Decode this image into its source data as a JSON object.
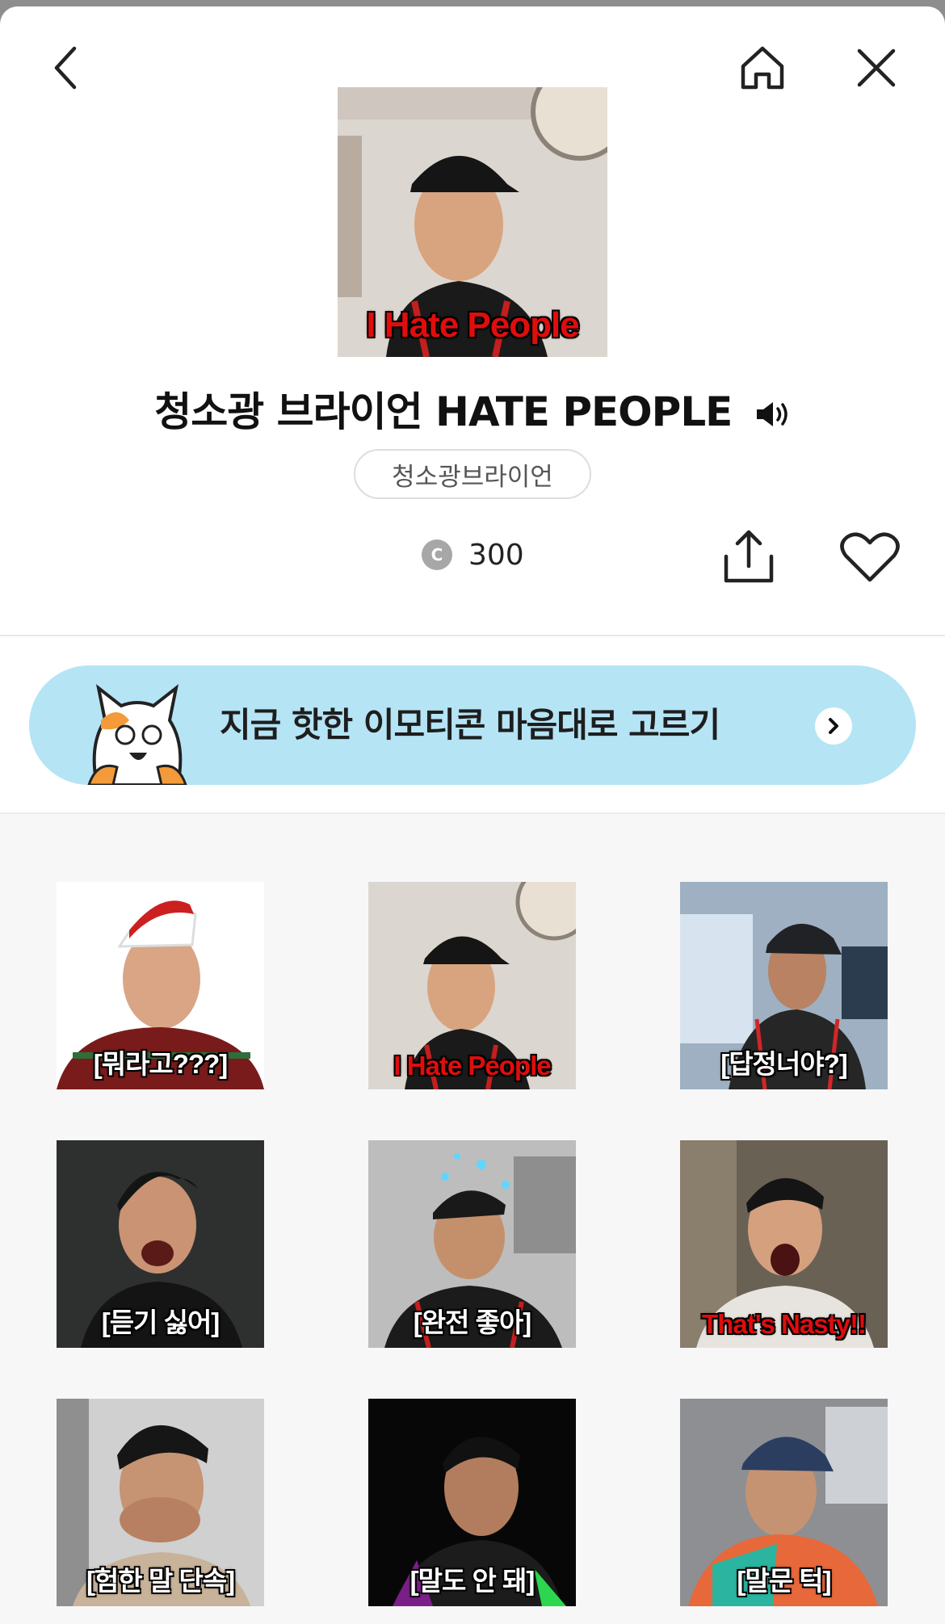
{
  "header": {
    "back_icon": "chevron-left-icon",
    "home_icon": "home-icon",
    "close_icon": "close-icon"
  },
  "product": {
    "hero_caption": "I Hate People",
    "title": "청소광 브라이언 HATE PEOPLE",
    "author": "청소광브라이언",
    "coin_symbol": "C",
    "price": "300"
  },
  "banner": {
    "text": "지금 핫한 이모티콘 마음대로 고르기",
    "colors": {
      "background": "#b5e4f5"
    }
  },
  "stickers": [
    {
      "caption": "[뭐라고???]"
    },
    {
      "caption": "I Hate People"
    },
    {
      "caption": "[답정너야?]"
    },
    {
      "caption": "[듣기 싫어]"
    },
    {
      "caption": "[완전 좋아]"
    },
    {
      "caption": "That's Nasty!!"
    },
    {
      "caption": "[험한 말 단속]"
    },
    {
      "caption": "[말도 안 돼]"
    },
    {
      "caption": "[말문 턱]"
    }
  ],
  "colors": {
    "caption_red": "#e00d0d",
    "caption_white": "#ffffff"
  }
}
